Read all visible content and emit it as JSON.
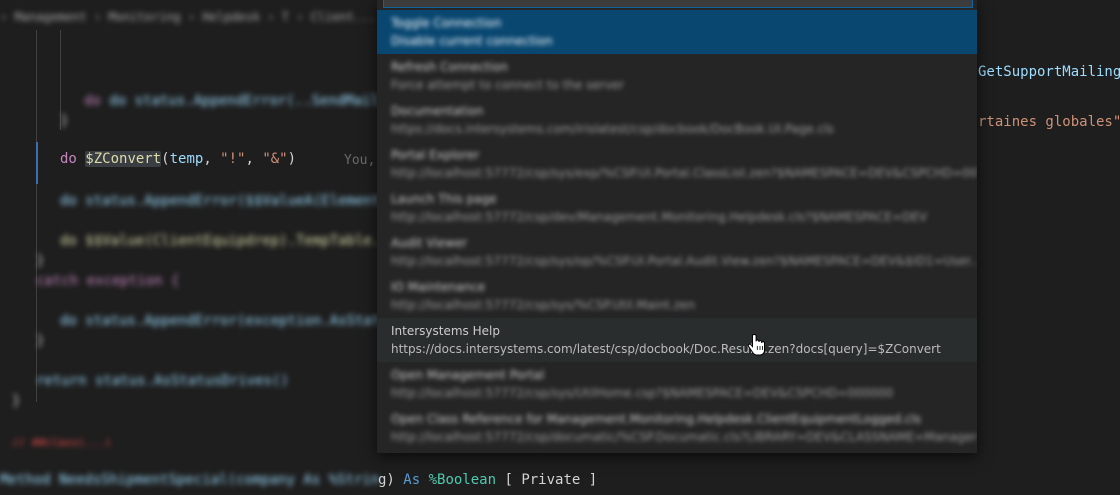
{
  "editor": {
    "breadcrumb": "› Management › Monitoring › Helpdesk › T  › Client...",
    "blurred_lines": [
      "do status.AppendError(..SendMailStat...",
      "}",
      "do status.AppendError($$ValueA(ElementId...",
      "do $$Value(ClientEquipdrep).TempTable...",
      "}",
      "catch exception {",
      "do status.AppendError(exception.AsStatus())",
      "}",
      "return status.AsStatusDrives()",
      "}"
    ],
    "focus_line": {
      "keyword": "do",
      "function": "$ZConvert",
      "open_paren": "(",
      "arg1": "temp",
      "comma": ", ",
      "arg2": "\"!\"",
      "arg3": "\"&\"",
      "close_paren": ")"
    },
    "inline_blame": "You,",
    "right_code": {
      "line1": "GetSupportMailing",
      "line2": "rtaines globales\");"
    },
    "bottom_line": {
      "blurred_prefix": "Method NeedsShipmentSpecial(company As %String",
      "tail_close": "g) ",
      "as_kw": "As",
      "type": "%Boolean",
      "modifiers": " [ Private ]"
    },
    "error_text": "// ##class(...)"
  },
  "quickpick": {
    "items": [
      {
        "label": "Toggle Connection",
        "description": "Disable current connection",
        "state": "selected",
        "blurred": true
      },
      {
        "label": "Refresh Connection",
        "description": "Force attempt to connect to the server",
        "state": "normal",
        "blurred": true
      },
      {
        "label": "Documentation",
        "description": "https://docs.intersystems.com/irislatest/csp/docbook/DocBook.UI.Page.cls",
        "state": "normal",
        "blurred": true
      },
      {
        "label": "Portal Explorer",
        "description": "http://localhost:57772/csp/sys/exp/%CSP.UI.Portal.ClassList.zen?$NAMESPACE=DEV&CSPCHD=000000",
        "state": "normal",
        "blurred": true
      },
      {
        "label": "Launch This page",
        "description": "http://localhost:57772/csp/dev/Management.Monitoring.Helpdesk.cls?$NAMESPACE=DEV",
        "state": "normal",
        "blurred": true
      },
      {
        "label": "Audit Viewer",
        "description": "http://localhost:57772/csp/sys/op/%CSP.UI.Portal.Audit.View.zen?$NAMESPACE=DEV&$ID1=User...",
        "state": "normal",
        "blurred": true
      },
      {
        "label": "IO Maintenance",
        "description": "http://localhost:57772/csp/sys/%CSP.Util.Maint.zen",
        "state": "normal",
        "blurred": true
      },
      {
        "label": "Intersystems Help",
        "description": "https://docs.intersystems.com/latest/csp/docbook/Doc.Results.zen?docs[query]=$ZConvert",
        "state": "hover",
        "blurred": false
      },
      {
        "label": "Open Management Portal",
        "description": "http://localhost:57772/csp/sys/UtilHome.csp?$NAMESPACE=DEV&CSPCHD=000000",
        "state": "normal",
        "blurred": true
      },
      {
        "label": "Open Class Reference for Management.Monitoring.Helpdesk.ClientEquipmentLogged.cls",
        "description": "http://localhost:57772/csp/documatic/%CSP.Documatic.cls?LIBRARY=DEV&CLASSNAME=Management...",
        "state": "normal",
        "blurred": true
      }
    ]
  },
  "icons": {
    "cursor": "hand-pointer-icon"
  }
}
